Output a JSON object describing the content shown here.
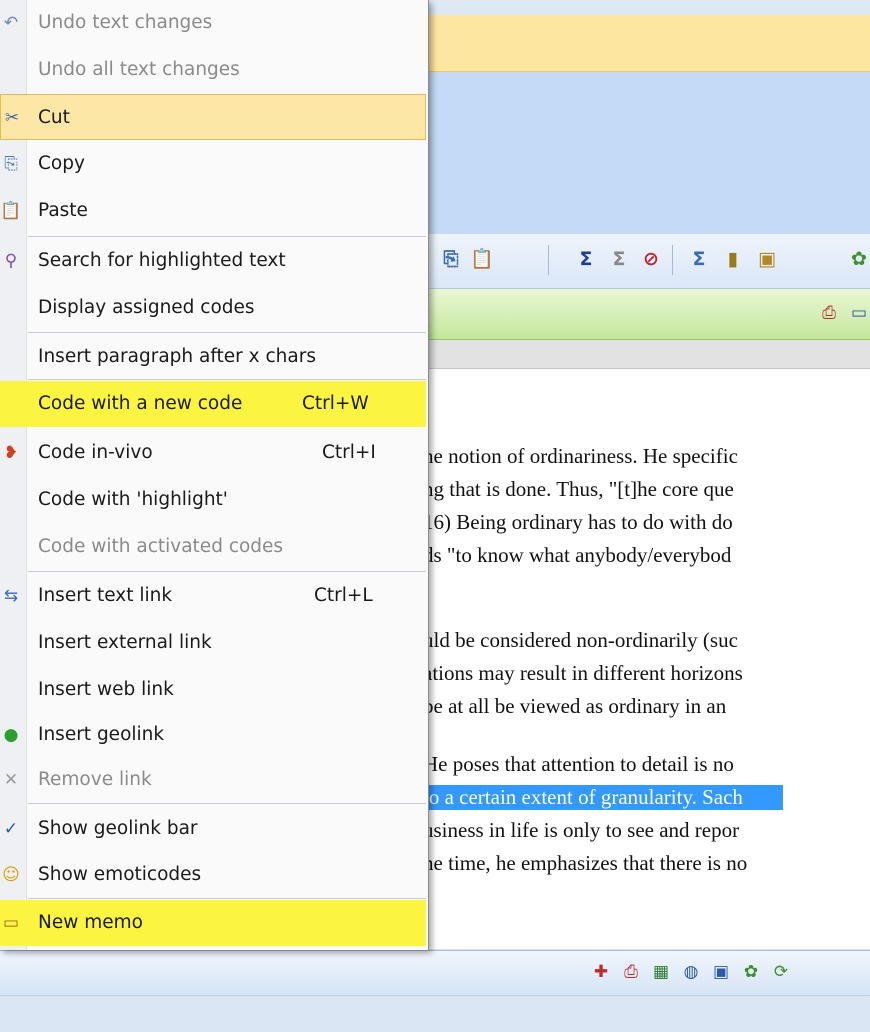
{
  "menu": {
    "items": [
      {
        "label": "Undo text changes",
        "shortcut": "",
        "icon": "undo-icon",
        "state": "disabled"
      },
      {
        "label": "Undo all text changes",
        "shortcut": "",
        "icon": "",
        "state": "disabled"
      },
      {
        "label": "Cut",
        "shortcut": "",
        "icon": "scissors-icon",
        "state": "hover"
      },
      {
        "label": "Copy",
        "shortcut": "",
        "icon": "copy-icon",
        "state": "enabled"
      },
      {
        "label": "Paste",
        "shortcut": "",
        "icon": "paste-icon",
        "state": "enabled"
      },
      {
        "label": "Search for highlighted text",
        "shortcut": "",
        "icon": "search-icon",
        "state": "enabled"
      },
      {
        "label": "Display assigned codes",
        "shortcut": "",
        "icon": "",
        "state": "enabled"
      },
      {
        "label": "Insert paragraph after x chars",
        "shortcut": "",
        "icon": "",
        "state": "enabled"
      },
      {
        "label": "Code with a new code",
        "shortcut": "Ctrl+W",
        "icon": "",
        "state": "highlighted"
      },
      {
        "label": "Code in-vivo",
        "shortcut": "Ctrl+I",
        "icon": "code-invivo-icon",
        "state": "enabled"
      },
      {
        "label": "Code with 'highlight'",
        "shortcut": "",
        "icon": "",
        "state": "enabled"
      },
      {
        "label": "Code with activated codes",
        "shortcut": "",
        "icon": "",
        "state": "disabled"
      },
      {
        "label": "Insert text link",
        "shortcut": "Ctrl+L",
        "icon": "text-link-icon",
        "state": "enabled"
      },
      {
        "label": "Insert external link",
        "shortcut": "",
        "icon": "",
        "state": "enabled"
      },
      {
        "label": "Insert web link",
        "shortcut": "",
        "icon": "",
        "state": "enabled"
      },
      {
        "label": "Insert geolink",
        "shortcut": "",
        "icon": "geolink-icon",
        "state": "enabled"
      },
      {
        "label": "Remove link",
        "shortcut": "",
        "icon": "remove-link-icon",
        "state": "disabled"
      },
      {
        "label": "Show geolink bar",
        "shortcut": "",
        "icon": "checkmark-icon",
        "state": "enabled"
      },
      {
        "label": "Show emoticodes",
        "shortcut": "",
        "icon": "emoticon-icon",
        "state": "enabled"
      },
      {
        "label": "New memo",
        "shortcut": "",
        "icon": "memo-icon",
        "state": "highlighted"
      }
    ]
  },
  "document": {
    "lines": [
      "he notion of ordinariness. He specific",
      "ng that is done. Thus, \"[t]he core que",
      "16) Being ordinary has to do with do",
      "ds \"to know what anybody/everybod",
      "uld be considered non-ordinarily (suc",
      "ations may result in different horizons",
      " be at all be viewed as ordinary in an",
      " He poses that attention to detail is no",
      "to a certain extent of granularity. Sach",
      "usiness in life is only to see and repor",
      "he time, he emphasizes that there is no"
    ]
  },
  "colors": {
    "menu_hover": "#fde7a6",
    "menu_highlight": "#fbf542",
    "selection": "#3399ff",
    "disabled_text": "#8a8a8a"
  }
}
